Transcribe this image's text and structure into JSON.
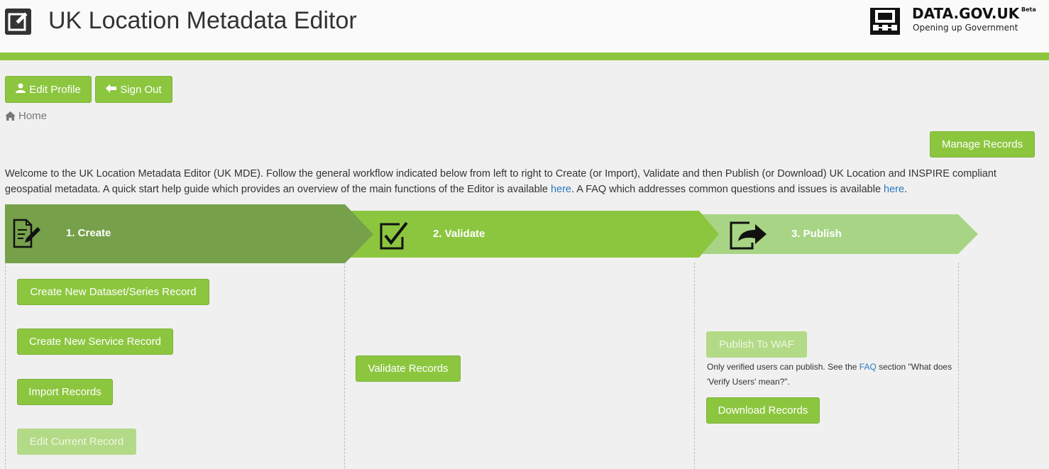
{
  "header": {
    "title": "UK Location Metadata Editor",
    "app_icon": "edit-square-icon",
    "brand": {
      "name": "DATA.GOV.UK",
      "beta": "Beta",
      "tagline": "Opening up Government",
      "logo_icon": "data-gov-uk-logo"
    },
    "accent_color": "#8cc63f"
  },
  "user_nav": {
    "edit_profile": "Edit Profile",
    "edit_profile_icon": "user-icon",
    "sign_out": "Sign Out",
    "sign_out_icon": "arrow-left-icon"
  },
  "breadcrumb": {
    "home": "Home",
    "home_icon": "home-icon"
  },
  "manage_records": "Manage Records",
  "intro": {
    "text_1": "Welcome to the UK Location Metadata Editor (UK MDE). Follow the general workflow indicated below from left to right to Create (or Import), Validate and then Publish (or Download) UK Location and INSPIRE compliant geospatial metadata. A quick start help guide which provides an overview of the main functions of the Editor is available ",
    "link_1": "here",
    "text_2": ". A FAQ which addresses common questions and issues is available ",
    "link_2": "here",
    "text_3": "."
  },
  "stages": [
    {
      "label": "1. Create",
      "icon": "document-edit-icon",
      "color": "#76a04a",
      "buttons": [
        {
          "label": "Create New Dataset/Series Record",
          "enabled": true
        },
        {
          "label": "Create New Service Record",
          "enabled": true
        },
        {
          "label": "Import Records",
          "enabled": true
        },
        {
          "label": "Edit Current Record",
          "enabled": false
        }
      ]
    },
    {
      "label": "2. Validate",
      "icon": "checkbox-check-icon",
      "color": "#8cc63f",
      "buttons": [
        {
          "label": "Validate Records",
          "enabled": true
        }
      ]
    },
    {
      "label": "3. Publish",
      "icon": "share-arrow-icon",
      "color": "#a8d585",
      "buttons": [
        {
          "label": "Publish To WAF",
          "enabled": false
        },
        {
          "label": "Download Records",
          "enabled": true
        }
      ],
      "note": {
        "text_1": "Only verified users can publish. See the ",
        "link": "FAQ",
        "text_2": " section \"What does 'Verify Users' mean?\"."
      }
    }
  ]
}
